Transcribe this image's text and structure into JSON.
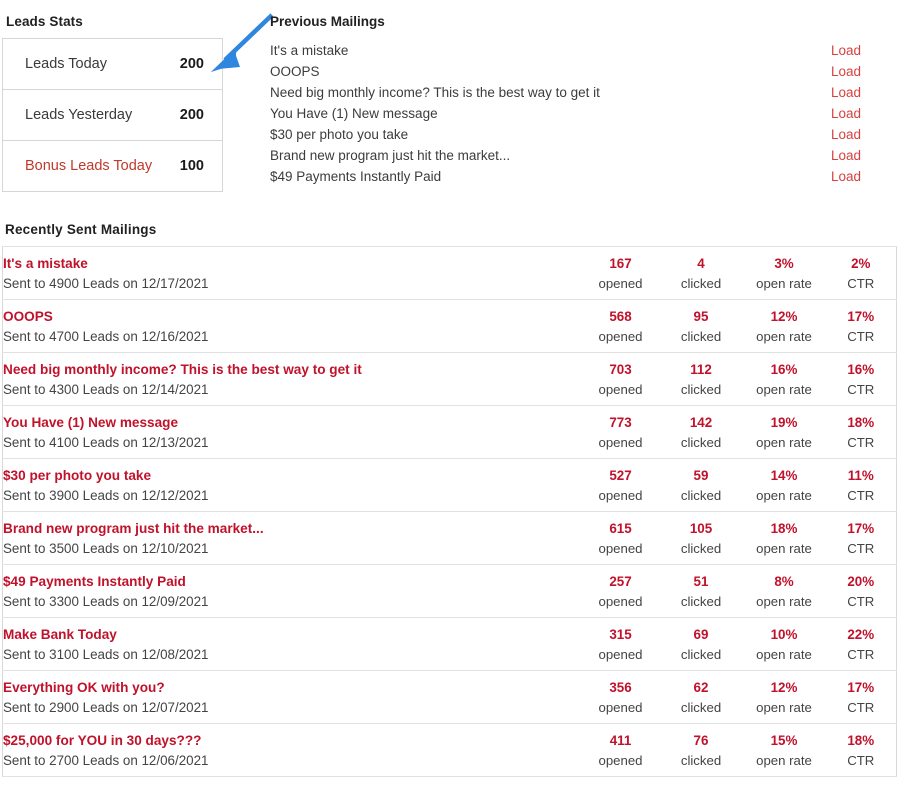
{
  "leads_stats": {
    "title": "Leads Stats",
    "rows": [
      {
        "label": "Leads Today",
        "value": "200",
        "highlight": false
      },
      {
        "label": "Leads Yesterday",
        "value": "200",
        "highlight": false
      },
      {
        "label": "Bonus Leads Today",
        "value": "100",
        "highlight": true
      }
    ]
  },
  "annotation": {
    "type": "arrow",
    "color": "#2e86de",
    "points_to": "Leads Today value"
  },
  "previous_mailings": {
    "title": "Previous Mailings",
    "load_label": "Load",
    "items": [
      {
        "subject": "It's a mistake",
        "action": "Load"
      },
      {
        "subject": "OOOPS",
        "action": "Load"
      },
      {
        "subject": "Need big monthly income? This is the best way to get it",
        "action": "Load"
      },
      {
        "subject": "You Have (1) New message",
        "action": "Load"
      },
      {
        "subject": "$30 per photo you take",
        "action": "Load"
      },
      {
        "subject": "Brand new program just hit the market...",
        "action": "Load"
      },
      {
        "subject": "$49 Payments Instantly Paid",
        "action": "Load"
      }
    ]
  },
  "recent_mailings": {
    "title": "Recently Sent Mailings",
    "labels": {
      "opened": "opened",
      "clicked": "clicked",
      "open_rate": "open rate",
      "ctr": "CTR"
    },
    "rows": [
      {
        "subject": "It's a mistake",
        "sent_line": "Sent to 4900 Leads on 12/17/2021",
        "opened": "167",
        "clicked": "4",
        "open_rate": "3%",
        "ctr": "2%"
      },
      {
        "subject": "OOOPS",
        "sent_line": "Sent to 4700 Leads on 12/16/2021",
        "opened": "568",
        "clicked": "95",
        "open_rate": "12%",
        "ctr": "17%"
      },
      {
        "subject": "Need big monthly income? This is the best way to get it",
        "sent_line": "Sent to 4300 Leads on 12/14/2021",
        "opened": "703",
        "clicked": "112",
        "open_rate": "16%",
        "ctr": "16%"
      },
      {
        "subject": "You Have (1) New message",
        "sent_line": "Sent to 4100 Leads on 12/13/2021",
        "opened": "773",
        "clicked": "142",
        "open_rate": "19%",
        "ctr": "18%"
      },
      {
        "subject": "$30 per photo you take",
        "sent_line": "Sent to 3900 Leads on 12/12/2021",
        "opened": "527",
        "clicked": "59",
        "open_rate": "14%",
        "ctr": "11%"
      },
      {
        "subject": "Brand new program just hit the market...",
        "sent_line": "Sent to 3500 Leads on 12/10/2021",
        "opened": "615",
        "clicked": "105",
        "open_rate": "18%",
        "ctr": "17%"
      },
      {
        "subject": "$49 Payments Instantly Paid",
        "sent_line": "Sent to 3300 Leads on 12/09/2021",
        "opened": "257",
        "clicked": "51",
        "open_rate": "8%",
        "ctr": "20%"
      },
      {
        "subject": "Make Bank Today",
        "sent_line": "Sent to 3100 Leads on 12/08/2021",
        "opened": "315",
        "clicked": "69",
        "open_rate": "10%",
        "ctr": "22%"
      },
      {
        "subject": "Everything OK with you?",
        "sent_line": "Sent to 2900 Leads on 12/07/2021",
        "opened": "356",
        "clicked": "62",
        "open_rate": "12%",
        "ctr": "17%"
      },
      {
        "subject": "$25,000 for YOU in 30 days???",
        "sent_line": "Sent to 2700 Leads on 12/06/2021",
        "opened": "411",
        "clicked": "76",
        "open_rate": "15%",
        "ctr": "18%"
      }
    ]
  },
  "colors": {
    "subject_red": "#c0122b",
    "load_red": "#d6413f",
    "bonus_red": "#c0392b",
    "arrow_blue": "#2e86de",
    "border_gray": "#d8d8d8"
  }
}
